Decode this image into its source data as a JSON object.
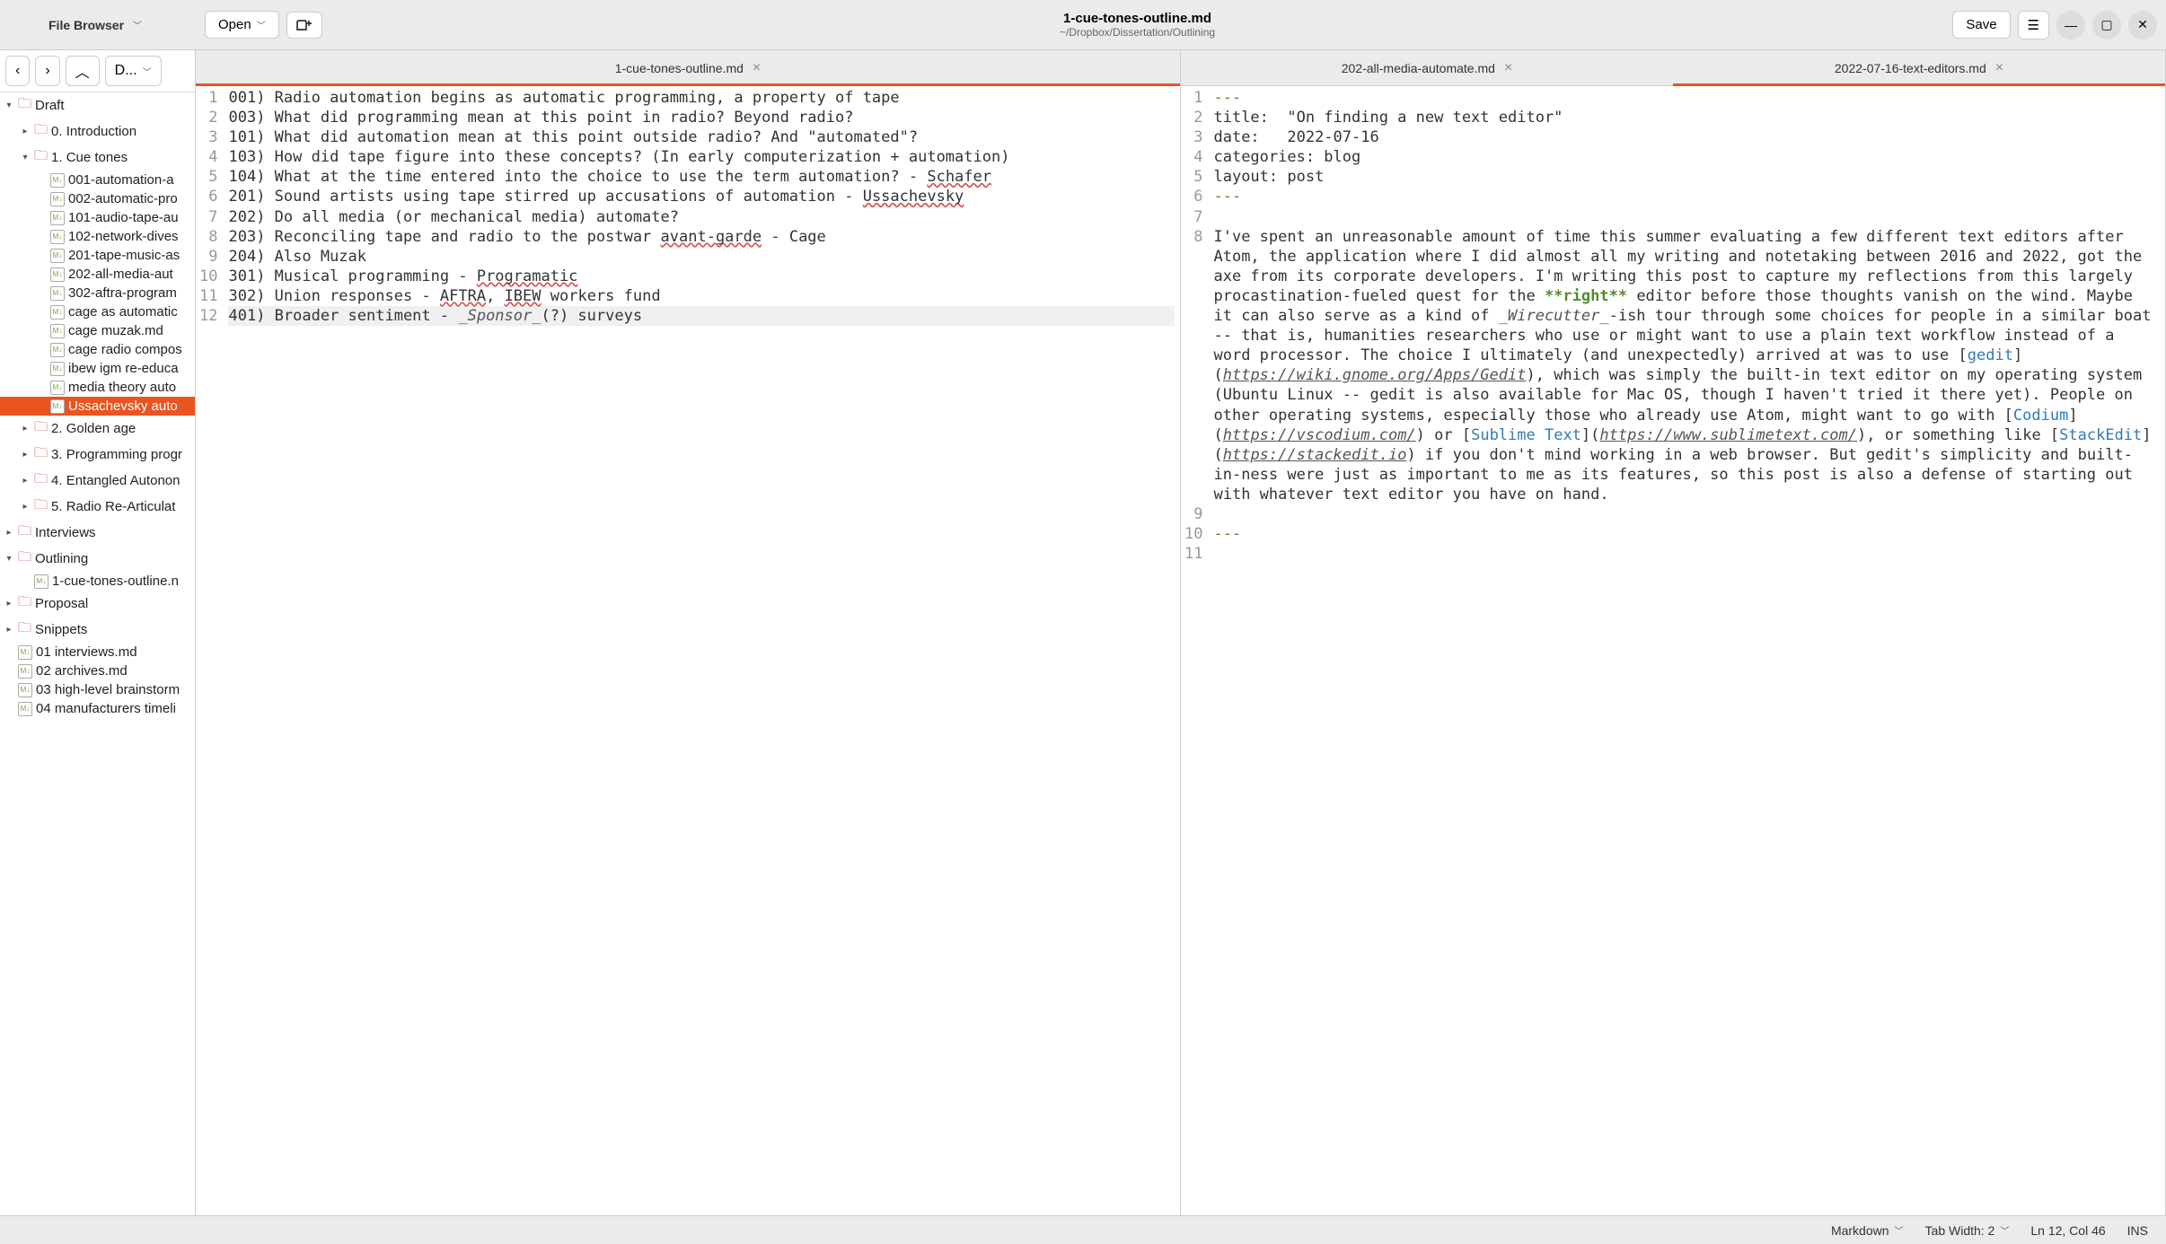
{
  "toolbar": {
    "file_browser_label": "File Browser",
    "open_label": "Open",
    "save_label": "Save",
    "doc_title": "1-cue-tones-outline.md",
    "doc_path": "~/Dropbox/Dissertation/Outlining"
  },
  "sidebar_nav": {
    "back": "‹",
    "forward": "›",
    "up": "︿",
    "path_label": "D..."
  },
  "tree": [
    {
      "indent": 0,
      "type": "folder",
      "label": "Draft",
      "expander": "▾"
    },
    {
      "indent": 1,
      "type": "folder",
      "label": "0. Introduction",
      "expander": "▸"
    },
    {
      "indent": 1,
      "type": "folder",
      "label": "1. Cue tones",
      "expander": "▾"
    },
    {
      "indent": 2,
      "type": "file",
      "label": "001-automation-a"
    },
    {
      "indent": 2,
      "type": "file",
      "label": "002-automatic-pro"
    },
    {
      "indent": 2,
      "type": "file",
      "label": "101-audio-tape-au"
    },
    {
      "indent": 2,
      "type": "file",
      "label": "102-network-dives"
    },
    {
      "indent": 2,
      "type": "file",
      "label": "201-tape-music-as"
    },
    {
      "indent": 2,
      "type": "file",
      "label": "202-all-media-aut"
    },
    {
      "indent": 2,
      "type": "file",
      "label": "302-aftra-program"
    },
    {
      "indent": 2,
      "type": "file",
      "label": "cage as automatic"
    },
    {
      "indent": 2,
      "type": "file",
      "label": "cage muzak.md"
    },
    {
      "indent": 2,
      "type": "file",
      "label": "cage radio compos"
    },
    {
      "indent": 2,
      "type": "file",
      "label": "ibew igm re-educa"
    },
    {
      "indent": 2,
      "type": "file",
      "label": "media theory auto"
    },
    {
      "indent": 2,
      "type": "file",
      "label": "Ussachevsky auto",
      "selected": true
    },
    {
      "indent": 1,
      "type": "folder",
      "label": "2. Golden age",
      "expander": "▸"
    },
    {
      "indent": 1,
      "type": "folder",
      "label": "3. Programming progr",
      "expander": "▸"
    },
    {
      "indent": 1,
      "type": "folder",
      "label": "4. Entangled Autonon",
      "expander": "▸"
    },
    {
      "indent": 1,
      "type": "folder",
      "label": "5. Radio Re-Articulat",
      "expander": "▸"
    },
    {
      "indent": 0,
      "type": "folder",
      "label": "Interviews",
      "expander": "▸"
    },
    {
      "indent": 0,
      "type": "folder",
      "label": "Outlining",
      "expander": "▾"
    },
    {
      "indent": 1,
      "type": "file",
      "label": "1-cue-tones-outline.n"
    },
    {
      "indent": 0,
      "type": "folder",
      "label": "Proposal",
      "expander": "▸"
    },
    {
      "indent": 0,
      "type": "folder",
      "label": "Snippets",
      "expander": "▸"
    },
    {
      "indent": 0,
      "type": "file",
      "label": "01 interviews.md"
    },
    {
      "indent": 0,
      "type": "file",
      "label": "02 archives.md"
    },
    {
      "indent": 0,
      "type": "file",
      "label": "03 high-level brainstorm"
    },
    {
      "indent": 0,
      "type": "file",
      "label": "04 manufacturers timeli"
    }
  ],
  "panes": [
    {
      "tabs": [
        {
          "label": "1-cue-tones-outline.md",
          "active": true
        }
      ],
      "lines": [
        {
          "num": 1,
          "segments": [
            {
              "t": "001) Radio automation begins as automatic programming, a property of tape"
            }
          ]
        },
        {
          "num": 2,
          "segments": [
            {
              "t": "003) What did programming mean at this point in radio? Beyond radio?"
            }
          ]
        },
        {
          "num": 3,
          "segments": [
            {
              "t": "101) What did automation mean at this point outside radio? And \"automated\"?"
            }
          ]
        },
        {
          "num": 4,
          "segments": [
            {
              "t": "103) How did tape figure into these concepts? (In early computerization + automation)"
            }
          ]
        },
        {
          "num": 5,
          "segments": [
            {
              "t": "104) What at the time entered into the choice to use the term automation? - "
            },
            {
              "t": "Schafer",
              "wavy": true
            }
          ]
        },
        {
          "num": 6,
          "segments": [
            {
              "t": "201) Sound artists using tape stirred up accusations of automation - "
            },
            {
              "t": "Ussachevsky",
              "wavy": true
            }
          ]
        },
        {
          "num": 7,
          "segments": [
            {
              "t": "202) Do all media (or mechanical media) automate?"
            }
          ]
        },
        {
          "num": 8,
          "segments": [
            {
              "t": "203) Reconciling tape and radio to the postwar "
            },
            {
              "t": "avant-garde",
              "wavy": true
            },
            {
              "t": " - Cage"
            }
          ]
        },
        {
          "num": 9,
          "segments": [
            {
              "t": "204) Also Muzak"
            }
          ]
        },
        {
          "num": 10,
          "segments": [
            {
              "t": "301) Musical programming - "
            },
            {
              "t": "Programatic",
              "wavy": true
            }
          ]
        },
        {
          "num": 11,
          "segments": [
            {
              "t": "302) Union responses - "
            },
            {
              "t": "AFTRA",
              "wavy": true
            },
            {
              "t": ", "
            },
            {
              "t": "IBEW",
              "wavy": true
            },
            {
              "t": " workers fund"
            }
          ]
        },
        {
          "num": 12,
          "cursor": true,
          "segments": [
            {
              "t": "401) Broader sentiment - "
            },
            {
              "t": "_Sponsor_",
              "cls": "md-italic"
            },
            {
              "t": "(?) surveys"
            }
          ]
        }
      ]
    },
    {
      "tabs": [
        {
          "label": "202-all-media-automate.md",
          "active": false
        },
        {
          "label": "2022-07-16-text-editors.md",
          "active": true
        }
      ],
      "lines": [
        {
          "num": 1,
          "segments": [
            {
              "t": "---",
              "cls": "md-hr"
            }
          ]
        },
        {
          "num": 2,
          "segments": [
            {
              "t": "title:  \"On finding a new text editor\""
            }
          ]
        },
        {
          "num": 3,
          "segments": [
            {
              "t": "date:   2022-07-16"
            }
          ]
        },
        {
          "num": 4,
          "segments": [
            {
              "t": "categories: blog"
            }
          ]
        },
        {
          "num": 5,
          "segments": [
            {
              "t": "layout: post"
            }
          ]
        },
        {
          "num": 6,
          "segments": [
            {
              "t": "---",
              "cls": "md-hr"
            }
          ]
        },
        {
          "num": 7,
          "segments": [
            {
              "t": ""
            }
          ]
        },
        {
          "num": 8,
          "segments": [
            {
              "t": "I've spent an unreasonable amount of time this summer evaluating a few different text editors after Atom, the application where I did almost all my writing and notetaking between 2016 and 2022, got the axe from its corporate developers. I'm writing this post to capture my reflections from this largely procastination-fueled quest for the "
            },
            {
              "t": "**right**",
              "cls": "md-bold"
            },
            {
              "t": " editor before those thoughts vanish on the wind. Maybe it can also serve as a kind of "
            },
            {
              "t": "_Wirecutter_",
              "cls": "md-italic"
            },
            {
              "t": "-ish tour through some choices for people in a similar boat -- that is, humanities researchers who use or might want to use a plain text workflow instead of a word processor. The choice I ultimately (and unexpectedly) arrived at was to use ["
            },
            {
              "t": "gedit",
              "cls": "md-link"
            },
            {
              "t": "]("
            },
            {
              "t": "https://wiki.gnome.org/Apps/Gedit",
              "cls": "md-url"
            },
            {
              "t": "), which was simply the built-in text editor on my operating system (Ubuntu Linux -- gedit is also available for Mac OS, though I haven't tried it there yet). People on other operating systems, especially those who already use Atom, might want to go with ["
            },
            {
              "t": "Codium",
              "cls": "md-link"
            },
            {
              "t": "]("
            },
            {
              "t": "https://vscodium.com/",
              "cls": "md-url"
            },
            {
              "t": ") or ["
            },
            {
              "t": "Sublime Text",
              "cls": "md-link"
            },
            {
              "t": "]("
            },
            {
              "t": "https://www.sublimetext.com/",
              "cls": "md-url"
            },
            {
              "t": "), or something like ["
            },
            {
              "t": "StackEdit",
              "cls": "md-link"
            },
            {
              "t": "]("
            },
            {
              "t": "https://stackedit.io",
              "cls": "md-url"
            },
            {
              "t": ") if you don't mind working in a web browser. But gedit's simplicity and built-in-ness were just as important to me as its features, so this post is also a defense of starting out with whatever text editor you have on hand."
            }
          ]
        },
        {
          "num": 9,
          "segments": [
            {
              "t": ""
            }
          ]
        },
        {
          "num": 10,
          "segments": [
            {
              "t": "---",
              "cls": "md-hr"
            }
          ]
        },
        {
          "num": 11,
          "segments": [
            {
              "t": ""
            }
          ]
        }
      ]
    }
  ],
  "statusbar": {
    "syntax": "Markdown",
    "tab_width": "Tab Width: 2",
    "position": "Ln 12, Col 46",
    "mode": "INS"
  }
}
